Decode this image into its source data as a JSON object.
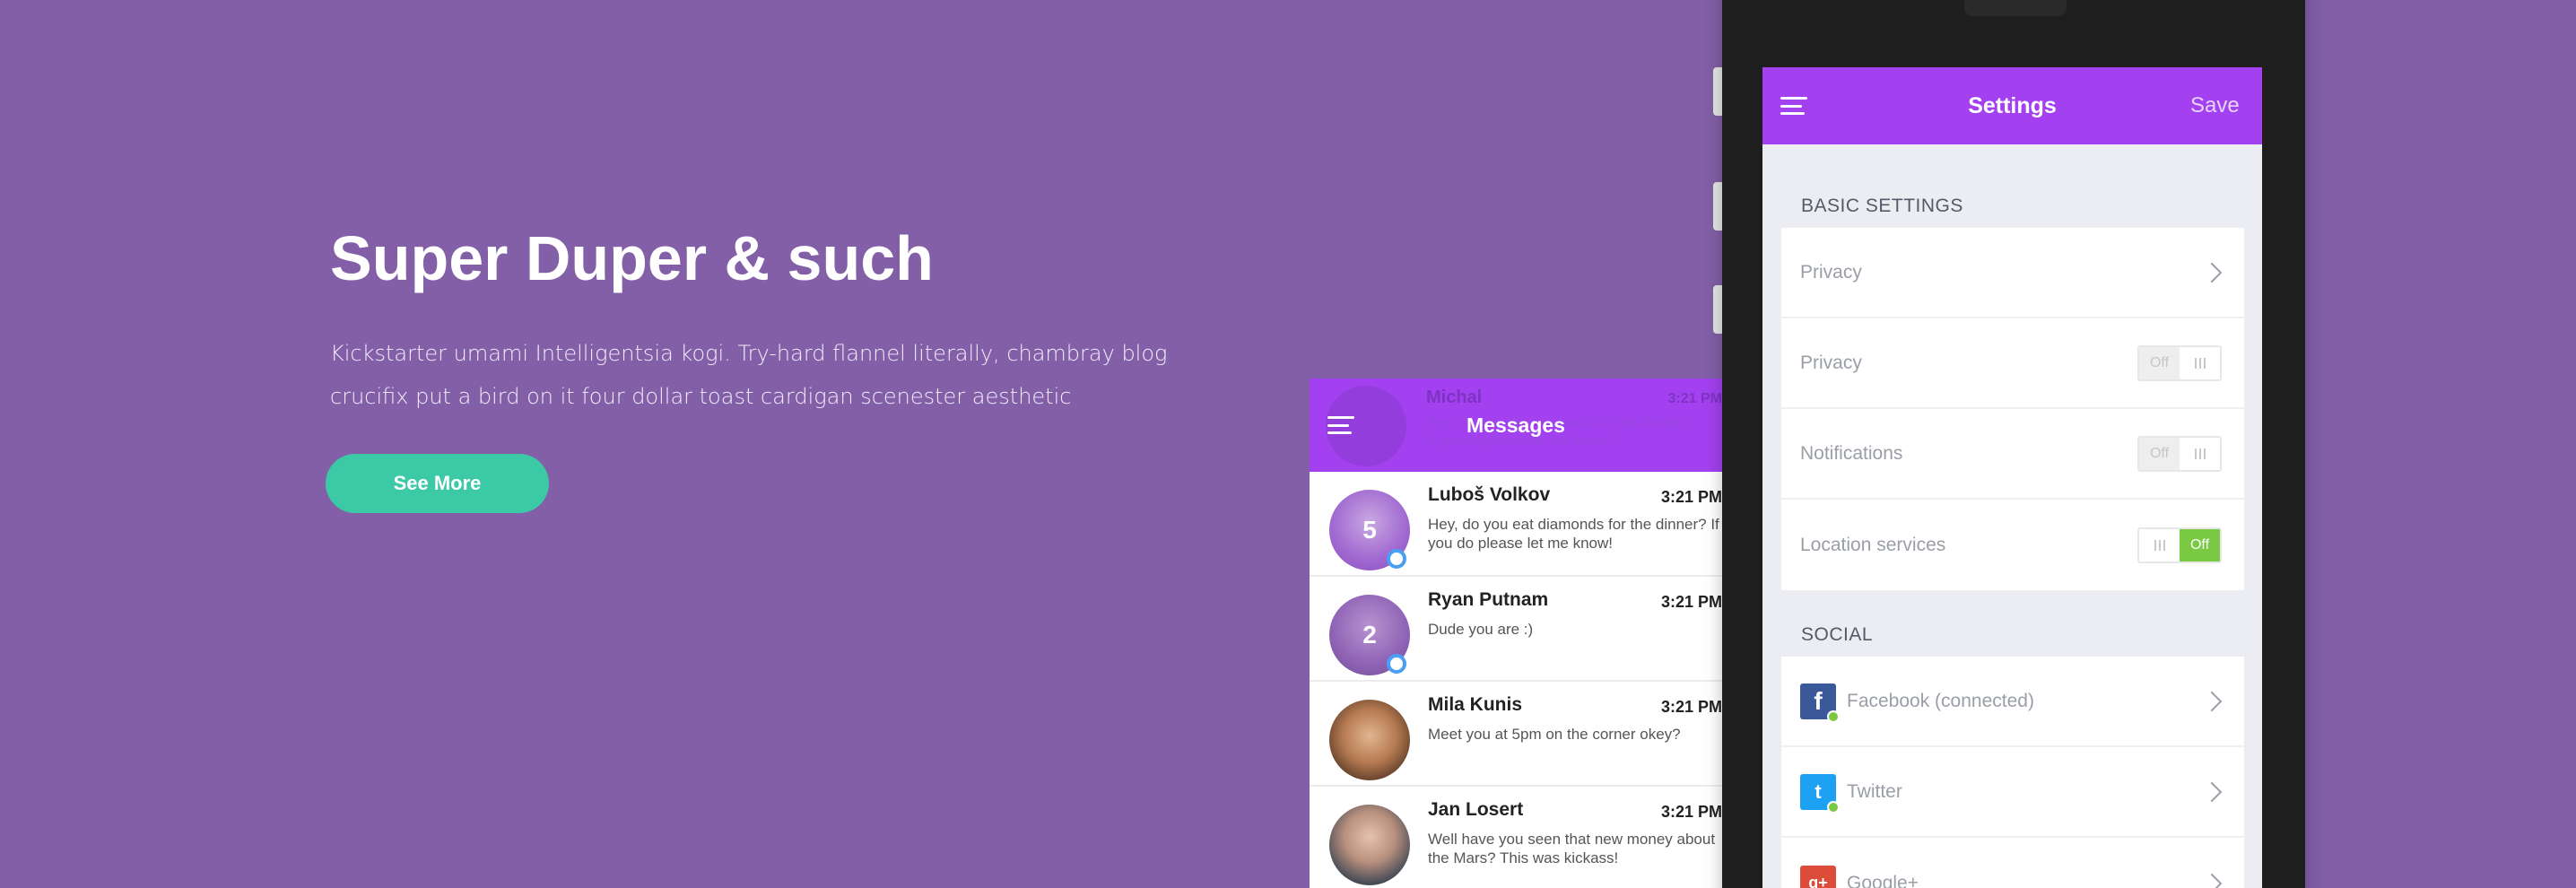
{
  "colors": {
    "background": "#825fa7",
    "accent": "#a341f0",
    "button": "#3cc9a5",
    "toggle_on": "#7ac943"
  },
  "hero": {
    "title": "Super Duper & such",
    "description_line1": "Kickstarter umami Intelligentsia kogi. Try-hard flannel literally, chambray blog",
    "description_line2": "crucifix put a bird on it four dollar toast cardigan scenester aesthetic",
    "button_label": "See More"
  },
  "messages": {
    "title": "Messages",
    "ghost": {
      "name": "Michal",
      "time": "3:21 PM",
      "line1": "Hey, do you eat diamonds for the dinner?",
      "line2": "If you do please let me know!"
    },
    "items": [
      {
        "name": "Luboš Volkov",
        "time": "3:21 PM",
        "preview": "Hey, do you eat diamonds for the dinner? If you do please let me know!",
        "count": "5",
        "online": true
      },
      {
        "name": "Ryan Putnam",
        "time": "3:21 PM",
        "preview": "Dude you are :)",
        "count": "2",
        "online": true
      },
      {
        "name": "Mila Kunis",
        "time": "3:21 PM",
        "preview": "Meet you at 5pm on the corner okey?",
        "count": "",
        "online": false
      },
      {
        "name": "Jan Losert",
        "time": "3:21 PM",
        "preview": "Well have you seen that new money about the Mars? This was kickass!",
        "count": "",
        "online": false
      }
    ]
  },
  "settings": {
    "title": "Settings",
    "save_label": "Save",
    "basic_section": "BASIC SETTINGS",
    "basic_rows": [
      {
        "label": "Privacy",
        "type": "chevron"
      },
      {
        "label": "Privacy",
        "type": "toggle",
        "state": "Off"
      },
      {
        "label": "Notifications",
        "type": "toggle",
        "state": "Off"
      },
      {
        "label": "Location services",
        "type": "toggle",
        "state": "Off"
      }
    ],
    "social_section": "SOCIAL",
    "social_rows": [
      {
        "label": "Facebook (connected)",
        "icon": "facebook-icon"
      },
      {
        "label": "Twitter",
        "icon": "twitter-icon"
      },
      {
        "label": "Google+",
        "icon": "google-plus-icon"
      }
    ]
  }
}
